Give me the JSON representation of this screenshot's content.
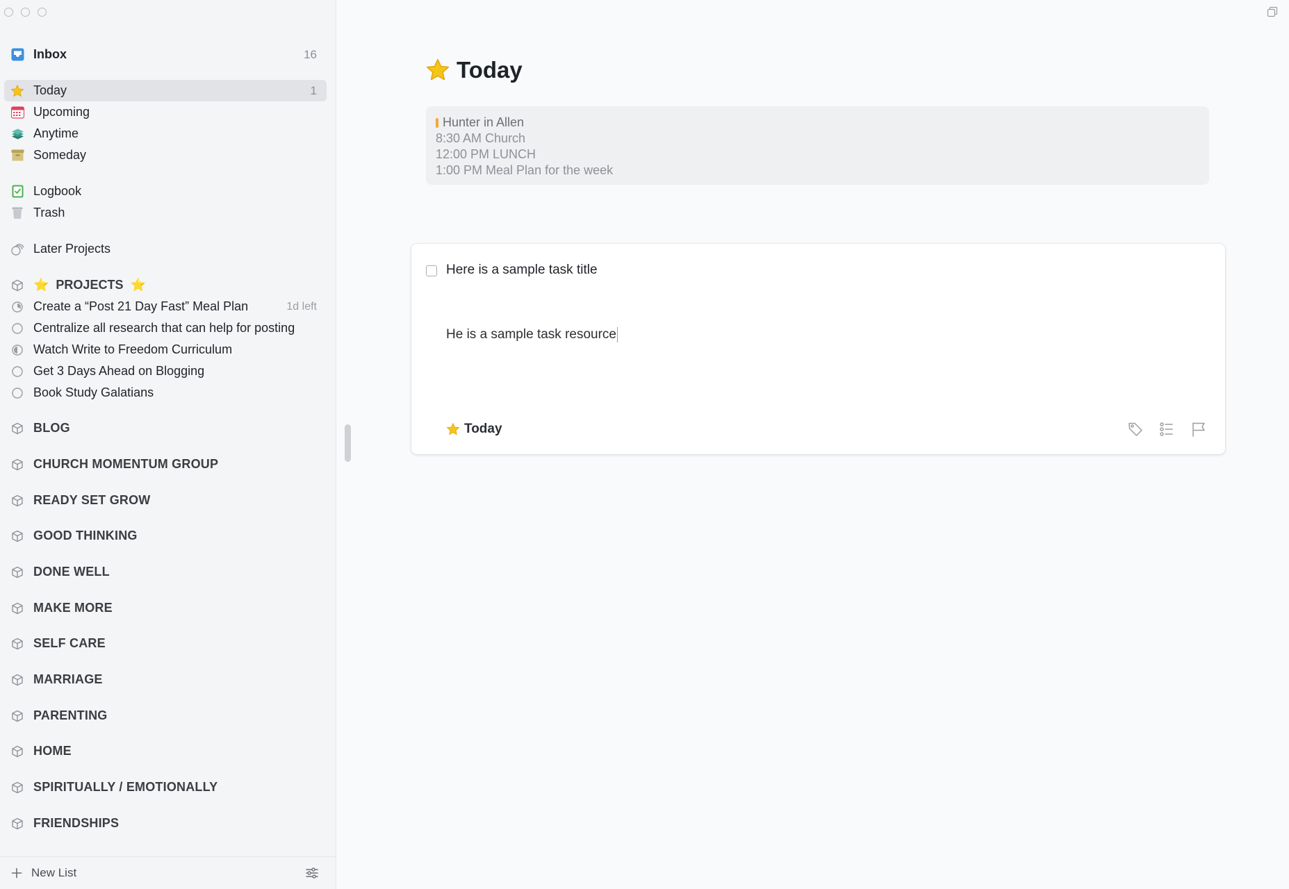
{
  "sidebar": {
    "inbox": {
      "label": "Inbox",
      "count": "16"
    },
    "views": [
      {
        "label": "Today",
        "count": "1"
      },
      {
        "label": "Upcoming",
        "count": ""
      },
      {
        "label": "Anytime",
        "count": ""
      },
      {
        "label": "Someday",
        "count": ""
      }
    ],
    "logbook": "Logbook",
    "trash": "Trash",
    "later_projects": "Later Projects",
    "projects_area": {
      "label": "PROJECTS",
      "prefix_emoji": "⭐️",
      "suffix_emoji": "⭐️"
    },
    "projects": [
      {
        "label": "Create a “Post 21 Day Fast” Meal Plan",
        "due": "1d left"
      },
      {
        "label": "Centralize all research that can help for posting",
        "due": ""
      },
      {
        "label": "Watch Write to Freedom Curriculum",
        "due": ""
      },
      {
        "label": "Get 3 Days Ahead on Blogging",
        "due": ""
      },
      {
        "label": "Book Study Galatians",
        "due": ""
      }
    ],
    "areas": [
      "BLOG",
      "CHURCH MOMENTUM GROUP",
      "READY SET GROW",
      "GOOD THINKING",
      "DONE WELL",
      "MAKE MORE",
      "SELF CARE",
      "MARRIAGE",
      "PARENTING",
      "HOME",
      "SPIRITUALLY / EMOTIONALLY",
      "FRIENDSHIPS"
    ],
    "new_list": "New List"
  },
  "main": {
    "title": "Today",
    "calendar": {
      "all_day": "Hunter in Allen",
      "events": [
        "8:30 AM Church",
        "12:00 PM LUNCH",
        "1:00 PM Meal Plan for the week"
      ]
    },
    "task": {
      "title": "Here is a sample task title",
      "notes": "He is a sample task resource",
      "when": "Today"
    }
  },
  "colors": {
    "accent_star": "#f5c518",
    "inbox_blue": "#3d8fe0",
    "upcoming_red": "#e0435f",
    "anytime_teal": "#3c9e8c",
    "someday_tan": "#c8b46a",
    "logbook_green": "#4caf50",
    "calendar_bar": "#f2a93b"
  }
}
